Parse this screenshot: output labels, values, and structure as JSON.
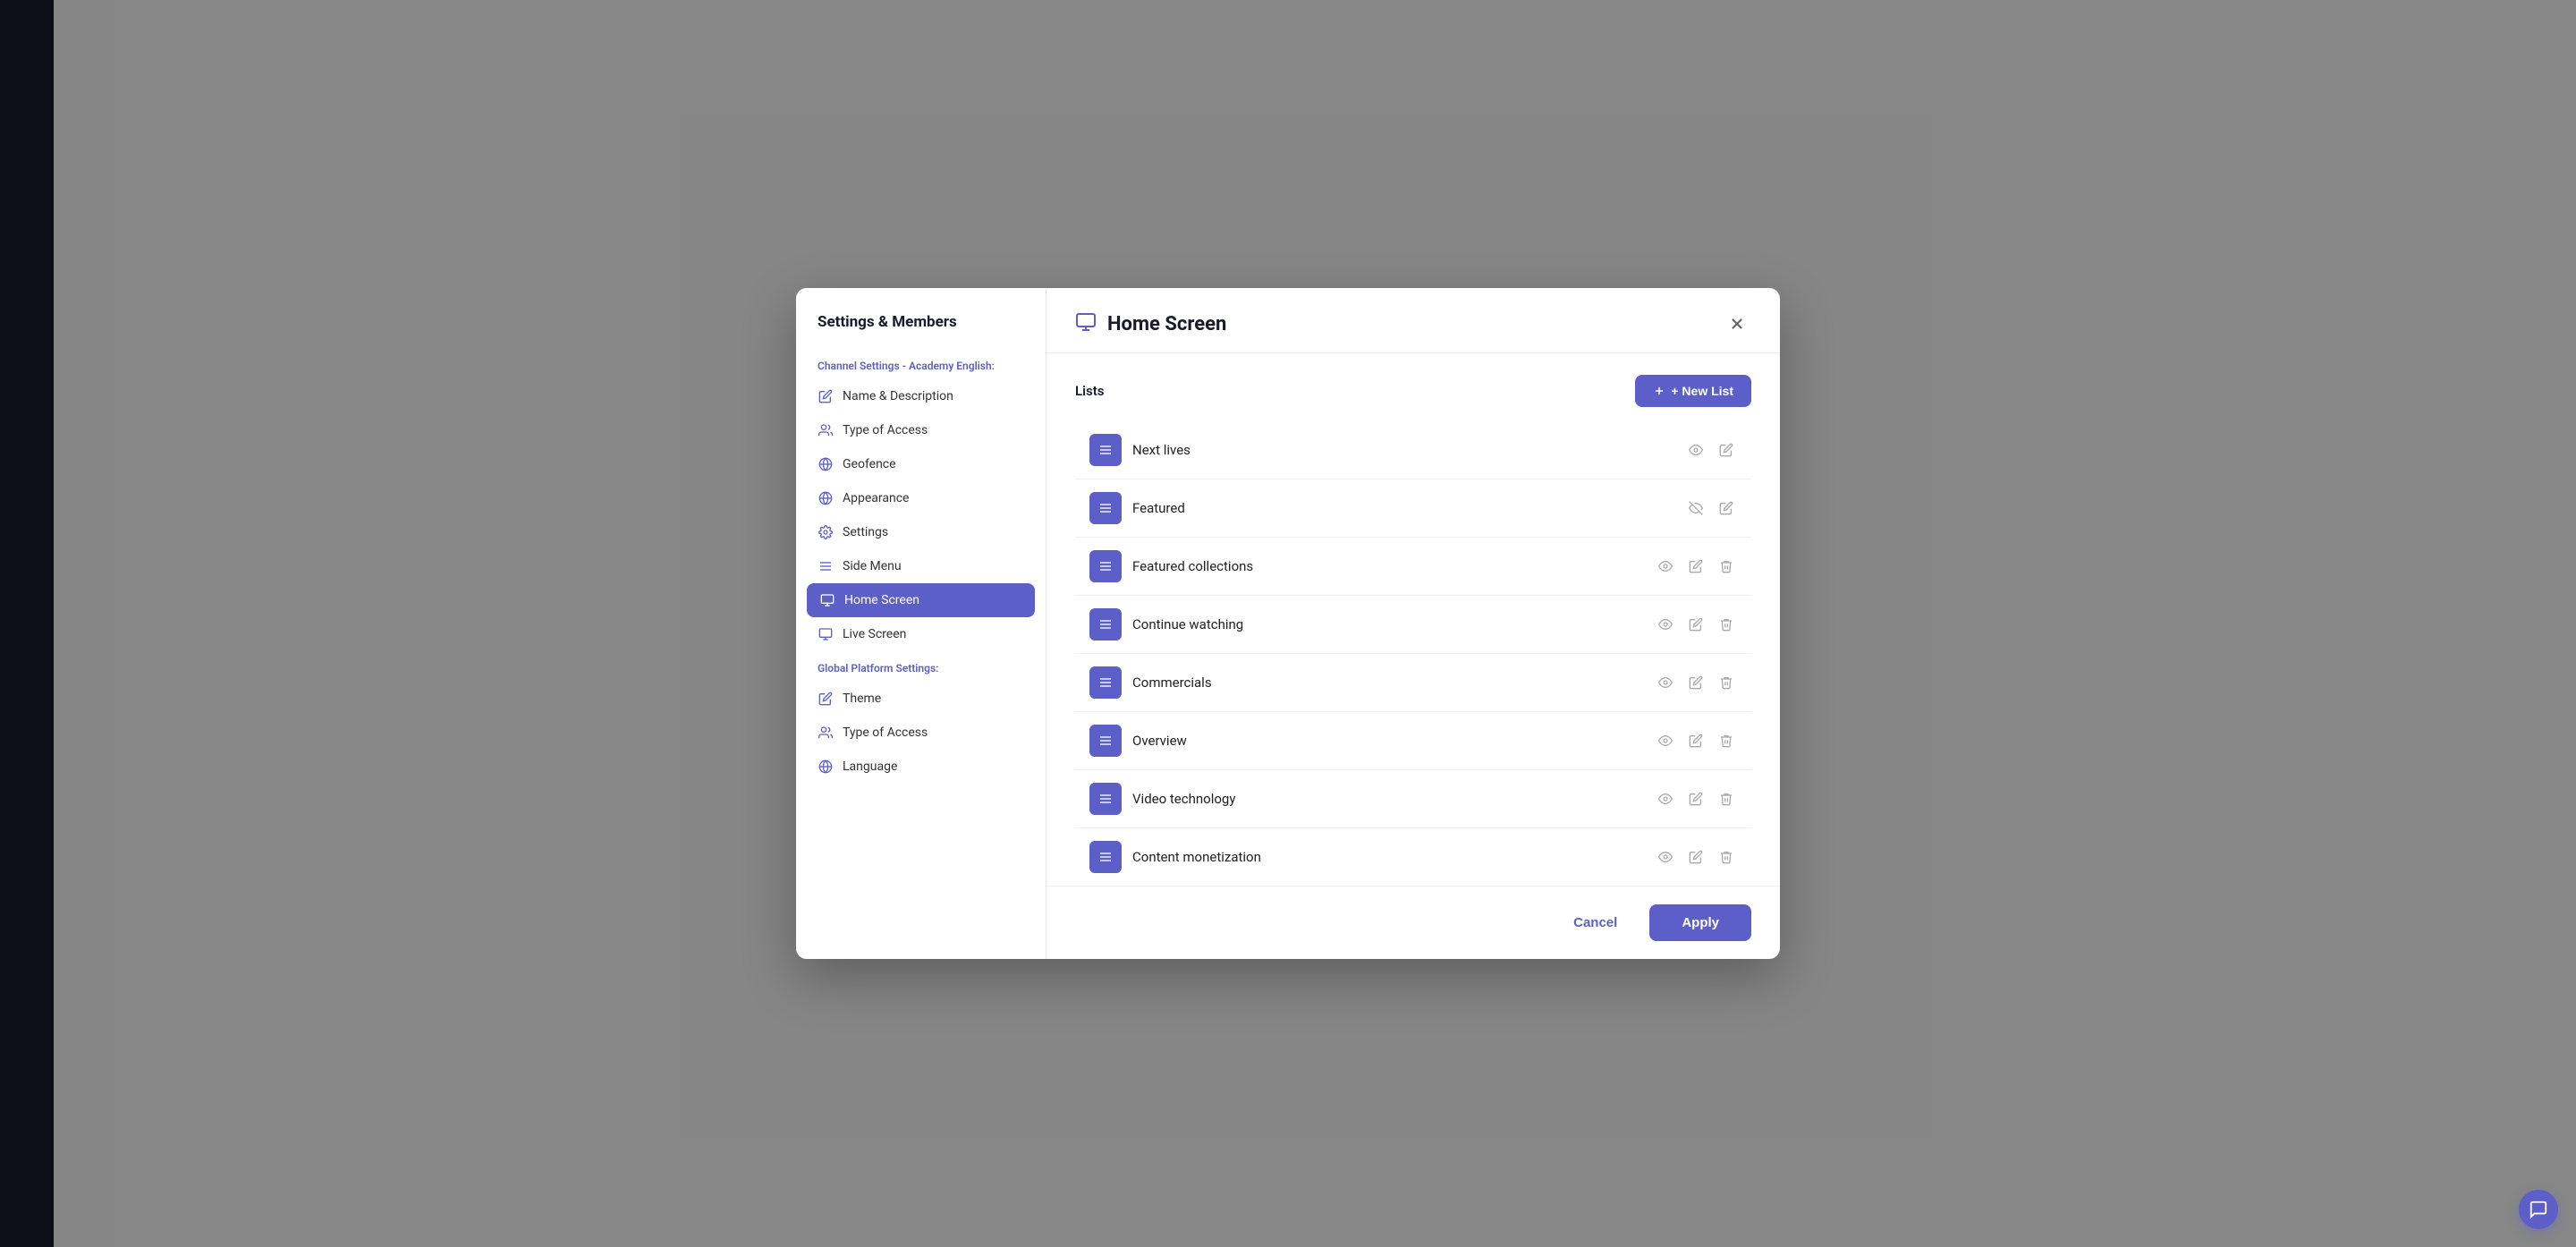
{
  "modal": {
    "title": "Home Screen",
    "close_label": "×",
    "header_icon": "▭"
  },
  "sidebar": {
    "title": "Settings & Members",
    "channel_section_label": "Channel Settings - Academy English:",
    "channel_items": [
      {
        "id": "name-description",
        "label": "Name & Description",
        "icon": "✏️"
      },
      {
        "id": "type-of-access",
        "label": "Type of Access",
        "icon": "👥"
      },
      {
        "id": "geofence",
        "label": "Geofence",
        "icon": "🌐"
      },
      {
        "id": "appearance",
        "label": "Appearance",
        "icon": "🌐"
      },
      {
        "id": "settings",
        "label": "Settings",
        "icon": "⚙️"
      },
      {
        "id": "side-menu",
        "label": "Side Menu",
        "icon": "☰"
      },
      {
        "id": "home-screen",
        "label": "Home Screen",
        "icon": "▭",
        "active": true
      },
      {
        "id": "live-screen",
        "label": "Live Screen",
        "icon": "▭"
      }
    ],
    "global_section_label": "Global Platform Settings:",
    "global_items": [
      {
        "id": "theme",
        "label": "Theme",
        "icon": "✏️"
      },
      {
        "id": "global-type-of-access",
        "label": "Type of Access",
        "icon": "👥"
      },
      {
        "id": "language",
        "label": "Language",
        "icon": "🌐"
      }
    ]
  },
  "lists": {
    "section_label": "Lists",
    "new_list_label": "+ New List",
    "items": [
      {
        "id": "next-lives",
        "name": "Next lives",
        "visible": true,
        "can_edit": true,
        "can_delete": false
      },
      {
        "id": "featured",
        "name": "Featured",
        "visible": false,
        "can_edit": true,
        "can_delete": false
      },
      {
        "id": "featured-collections",
        "name": "Featured collections",
        "visible": true,
        "can_edit": true,
        "can_delete": true
      },
      {
        "id": "continue-watching",
        "name": "Continue watching",
        "visible": true,
        "can_edit": true,
        "can_delete": true
      },
      {
        "id": "commercials",
        "name": "Commercials",
        "visible": true,
        "can_edit": true,
        "can_delete": true
      },
      {
        "id": "overview",
        "name": "Overview",
        "visible": true,
        "can_edit": true,
        "can_delete": true
      },
      {
        "id": "video-technology",
        "name": "Video technology",
        "visible": true,
        "can_edit": true,
        "can_delete": true
      },
      {
        "id": "content-monetization",
        "name": "Content monetization",
        "visible": true,
        "can_edit": true,
        "can_delete": true
      }
    ]
  },
  "footer": {
    "cancel_label": "Cancel",
    "apply_label": "Apply"
  },
  "support": {
    "icon": "💬"
  }
}
